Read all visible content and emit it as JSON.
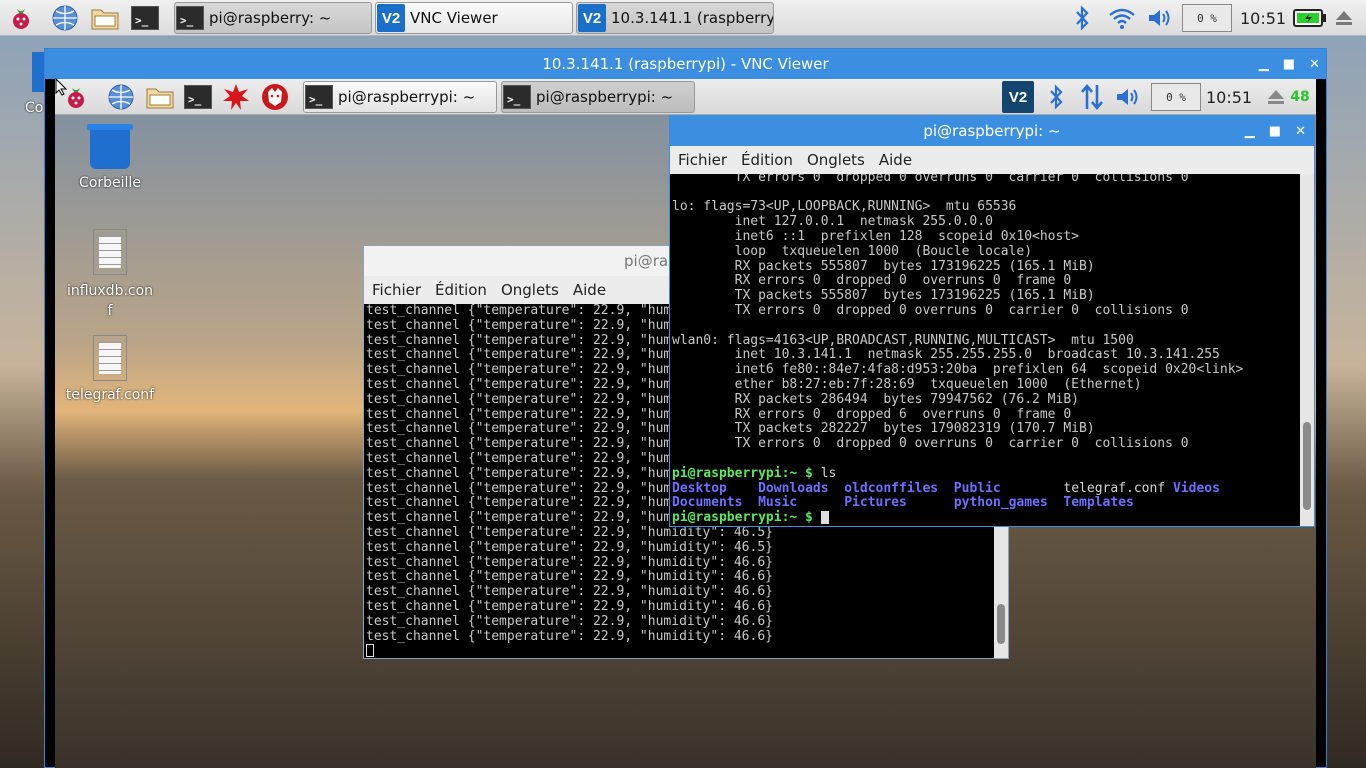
{
  "host_taskbar": {
    "tasks": [
      {
        "label": "pi@raspberry: ~",
        "icon": "terminal-icon"
      },
      {
        "label": "VNC Viewer",
        "icon": "vnc-icon"
      },
      {
        "label": "10.3.141.1 (raspberry…",
        "icon": "vnc-icon"
      }
    ],
    "cpu": "0 %",
    "clock": "10:51"
  },
  "host_desktop": {
    "partial_label": "Co"
  },
  "vnc_window": {
    "title": "10.3.141.1 (raspberrypi) - VNC Viewer"
  },
  "remote_taskbar": {
    "tasks": [
      {
        "label": "pi@raspberrypi: ~"
      },
      {
        "label": "pi@raspberrypi: ~"
      }
    ],
    "cpu": "0 %",
    "clock": "10:51",
    "count": "48"
  },
  "desktop_icons": [
    {
      "label": "Corbeille"
    },
    {
      "label": "influxdb.conf"
    },
    {
      "label": "telegraf.conf"
    }
  ],
  "terminal_back": {
    "title": "pi@ras",
    "menu": [
      "Fichier",
      "Édition",
      "Onglets",
      "Aide"
    ],
    "lines": [
      "test_channel {\"temperature\": 22.9, \"hum",
      "test_channel {\"temperature\": 22.9, \"hum",
      "test_channel {\"temperature\": 22.9, \"hum",
      "test_channel {\"temperature\": 22.9, \"hum",
      "test_channel {\"temperature\": 22.9, \"hum",
      "test_channel {\"temperature\": 22.9, \"hum",
      "test_channel {\"temperature\": 22.9, \"hum",
      "test_channel {\"temperature\": 22.9, \"hum",
      "test_channel {\"temperature\": 22.9, \"hum",
      "test_channel {\"temperature\": 22.9, \"hum",
      "test_channel {\"temperature\": 22.9, \"hum",
      "test_channel {\"temperature\": 22.9, \"hum",
      "test_channel {\"temperature\": 22.9, \"hum",
      "test_channel {\"temperature\": 22.9, \"hum",
      "test_channel {\"temperature\": 22.9, \"hum",
      "test_channel {\"temperature\": 22.9, \"humidity\": 46.5}",
      "test_channel {\"temperature\": 22.9, \"humidity\": 46.5}",
      "test_channel {\"temperature\": 22.9, \"humidity\": 46.6}",
      "test_channel {\"temperature\": 22.9, \"humidity\": 46.6}",
      "test_channel {\"temperature\": 22.9, \"humidity\": 46.6}",
      "test_channel {\"temperature\": 22.9, \"humidity\": 46.6}",
      "test_channel {\"temperature\": 22.9, \"humidity\": 46.6}",
      "test_channel {\"temperature\": 22.9, \"humidity\": 46.6}"
    ]
  },
  "terminal_front": {
    "title": "pi@raspberrypi: ~",
    "menu": [
      "Fichier",
      "Édition",
      "Onglets",
      "Aide"
    ],
    "lines": [
      "        TX errors 0  dropped 0 overruns 0  carrier 0  collisions 0",
      "",
      "lo: flags=73<UP,LOOPBACK,RUNNING>  mtu 65536",
      "        inet 127.0.0.1  netmask 255.0.0.0",
      "        inet6 ::1  prefixlen 128  scopeid 0x10<host>",
      "        loop  txqueuelen 1000  (Boucle locale)",
      "        RX packets 555807  bytes 173196225 (165.1 MiB)",
      "        RX errors 0  dropped 0  overruns 0  frame 0",
      "        TX packets 555807  bytes 173196225 (165.1 MiB)",
      "        TX errors 0  dropped 0 overruns 0  carrier 0  collisions 0",
      "",
      "wlan0: flags=4163<UP,BROADCAST,RUNNING,MULTICAST>  mtu 1500",
      "        inet 10.3.141.1  netmask 255.255.255.0  broadcast 10.3.141.255",
      "        inet6 fe80::84e7:4fa8:d953:20ba  prefixlen 64  scopeid 0x20<link>",
      "        ether b8:27:eb:7f:28:69  txqueuelen 1000  (Ethernet)",
      "        RX packets 286494  bytes 79947562 (76.2 MiB)",
      "        RX errors 0  dropped 6  overruns 0  frame 0",
      "        TX packets 282227  bytes 179082319 (170.7 MiB)",
      "        TX errors 0  dropped 0 overruns 0  carrier 0  collisions 0",
      ""
    ],
    "prompt": "pi@raspberrypi:~ $",
    "command": "ls",
    "ls_row1": [
      {
        "name": "Desktop",
        "type": "dir"
      },
      {
        "name": "Downloads",
        "type": "dir"
      },
      {
        "name": "oldconffiles",
        "type": "dir"
      },
      {
        "name": "Public",
        "type": "dir"
      },
      {
        "name": "telegraf.conf",
        "type": "file"
      },
      {
        "name": "Videos",
        "type": "dir"
      }
    ],
    "ls_row2": [
      {
        "name": "Documents",
        "type": "dir"
      },
      {
        "name": "Music",
        "type": "dir"
      },
      {
        "name": "Pictures",
        "type": "dir"
      },
      {
        "name": "python_games",
        "type": "dir"
      },
      {
        "name": "Templates",
        "type": "dir"
      }
    ]
  }
}
